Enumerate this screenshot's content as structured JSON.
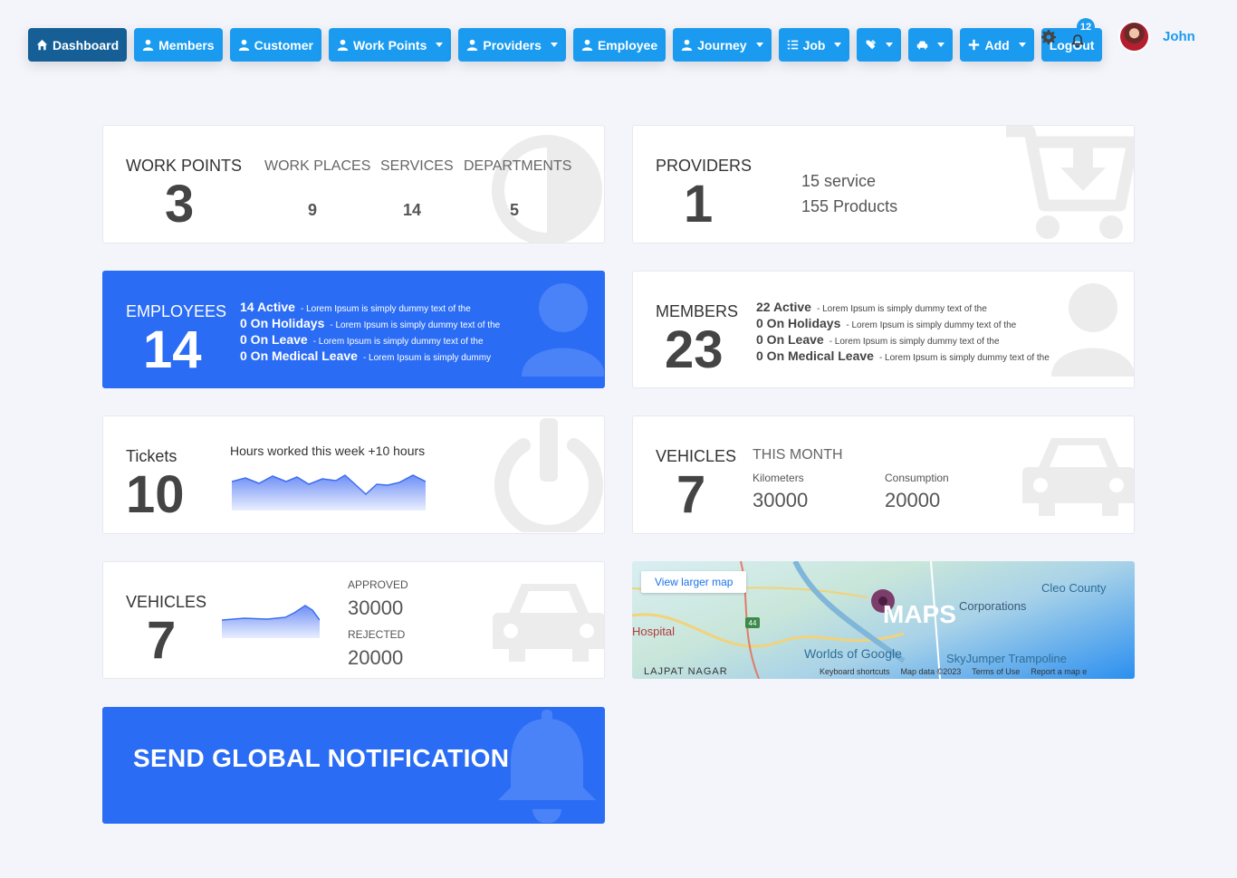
{
  "nav": {
    "items": [
      {
        "label": "Dashboard",
        "icon": "home-icon",
        "dropdown": false,
        "active": true
      },
      {
        "label": "Members",
        "icon": "user-icon",
        "dropdown": false
      },
      {
        "label": "Customer",
        "icon": "user-icon",
        "dropdown": false
      },
      {
        "label": "Work Points",
        "icon": "user-icon",
        "dropdown": true
      },
      {
        "label": "Providers",
        "icon": "user-icon",
        "dropdown": true
      },
      {
        "label": "Employee",
        "icon": "user-icon",
        "dropdown": false
      },
      {
        "label": "Journey",
        "icon": "user-icon",
        "dropdown": true
      },
      {
        "label": "Job",
        "icon": "list-icon",
        "dropdown": true
      },
      {
        "label": "",
        "icon": "tools-icon",
        "dropdown": true
      },
      {
        "label": "",
        "icon": "car-icon",
        "dropdown": true
      },
      {
        "label": "Add",
        "icon": "plus-icon",
        "dropdown": true
      },
      {
        "label": "LogOut",
        "icon": "",
        "dropdown": false
      }
    ]
  },
  "user": {
    "name": "John",
    "notifications": "12"
  },
  "workpoints": {
    "label": "WORK POINTS",
    "value": "3",
    "places_label": "WORK PLACES",
    "places": "9",
    "services_label": "SERVICES",
    "services": "14",
    "departments_label": "DEPARTMENTS",
    "departments": "5"
  },
  "providers": {
    "label": "PROVIDERS",
    "value": "1",
    "line1": "15 service",
    "line2": "155 Products"
  },
  "employees": {
    "label": "EMPLOYEES",
    "value": "14",
    "lines": [
      {
        "label": "14 Active",
        "note": "- Lorem Ipsum is simply dummy text of the"
      },
      {
        "label": "0 On Holidays",
        "note": "- Lorem Ipsum is simply dummy text of the"
      },
      {
        "label": "0 On Leave",
        "note": "- Lorem Ipsum is simply dummy text of the"
      },
      {
        "label": "0 On Medical Leave",
        "note": "- Lorem Ipsum is simply dummy"
      }
    ]
  },
  "members": {
    "label": "MEMBERS",
    "value": "23",
    "lines": [
      {
        "label": "22 Active",
        "note": "- Lorem Ipsum is simply dummy text of the"
      },
      {
        "label": "0 On Holidays",
        "note": "- Lorem Ipsum is simply dummy text of the"
      },
      {
        "label": "0 On Leave",
        "note": "- Lorem Ipsum is simply dummy text of the"
      },
      {
        "label": "0 On Medical Leave",
        "note": "- Lorem Ipsum is simply dummy text of the"
      }
    ]
  },
  "tickets": {
    "label": "Tickets",
    "value": "10",
    "hours_text": "Hours worked this week +10 hours"
  },
  "vehicles_month": {
    "label": "VEHICLES",
    "value": "7",
    "period": "THIS MONTH",
    "km_label": "Kilometers",
    "km": "30000",
    "cons_label": "Consumption",
    "cons": "20000"
  },
  "vehicles_status": {
    "label": "VEHICLES",
    "value": "7",
    "approved_label": "APPROVED",
    "approved": "30000",
    "rejected_label": "REJECTED",
    "rejected": "20000"
  },
  "map": {
    "title": "MAPS",
    "view_larger": "View larger map",
    "places": [
      "Hospital",
      "LAJPAT NAGAR",
      "Worlds of Google",
      "SkyJumper Trampoline",
      "Cleo County",
      "Corporations"
    ],
    "footer": [
      "Keyboard shortcuts",
      "Map data ©2023",
      "Terms of Use",
      "Report a map e"
    ],
    "road": "44"
  },
  "notification": {
    "label": "SEND GLOBAL NOTIFICATION"
  },
  "colors": {
    "primary": "#1a9bf0",
    "active": "#155f96",
    "card_blue": "#2b6cf5"
  }
}
